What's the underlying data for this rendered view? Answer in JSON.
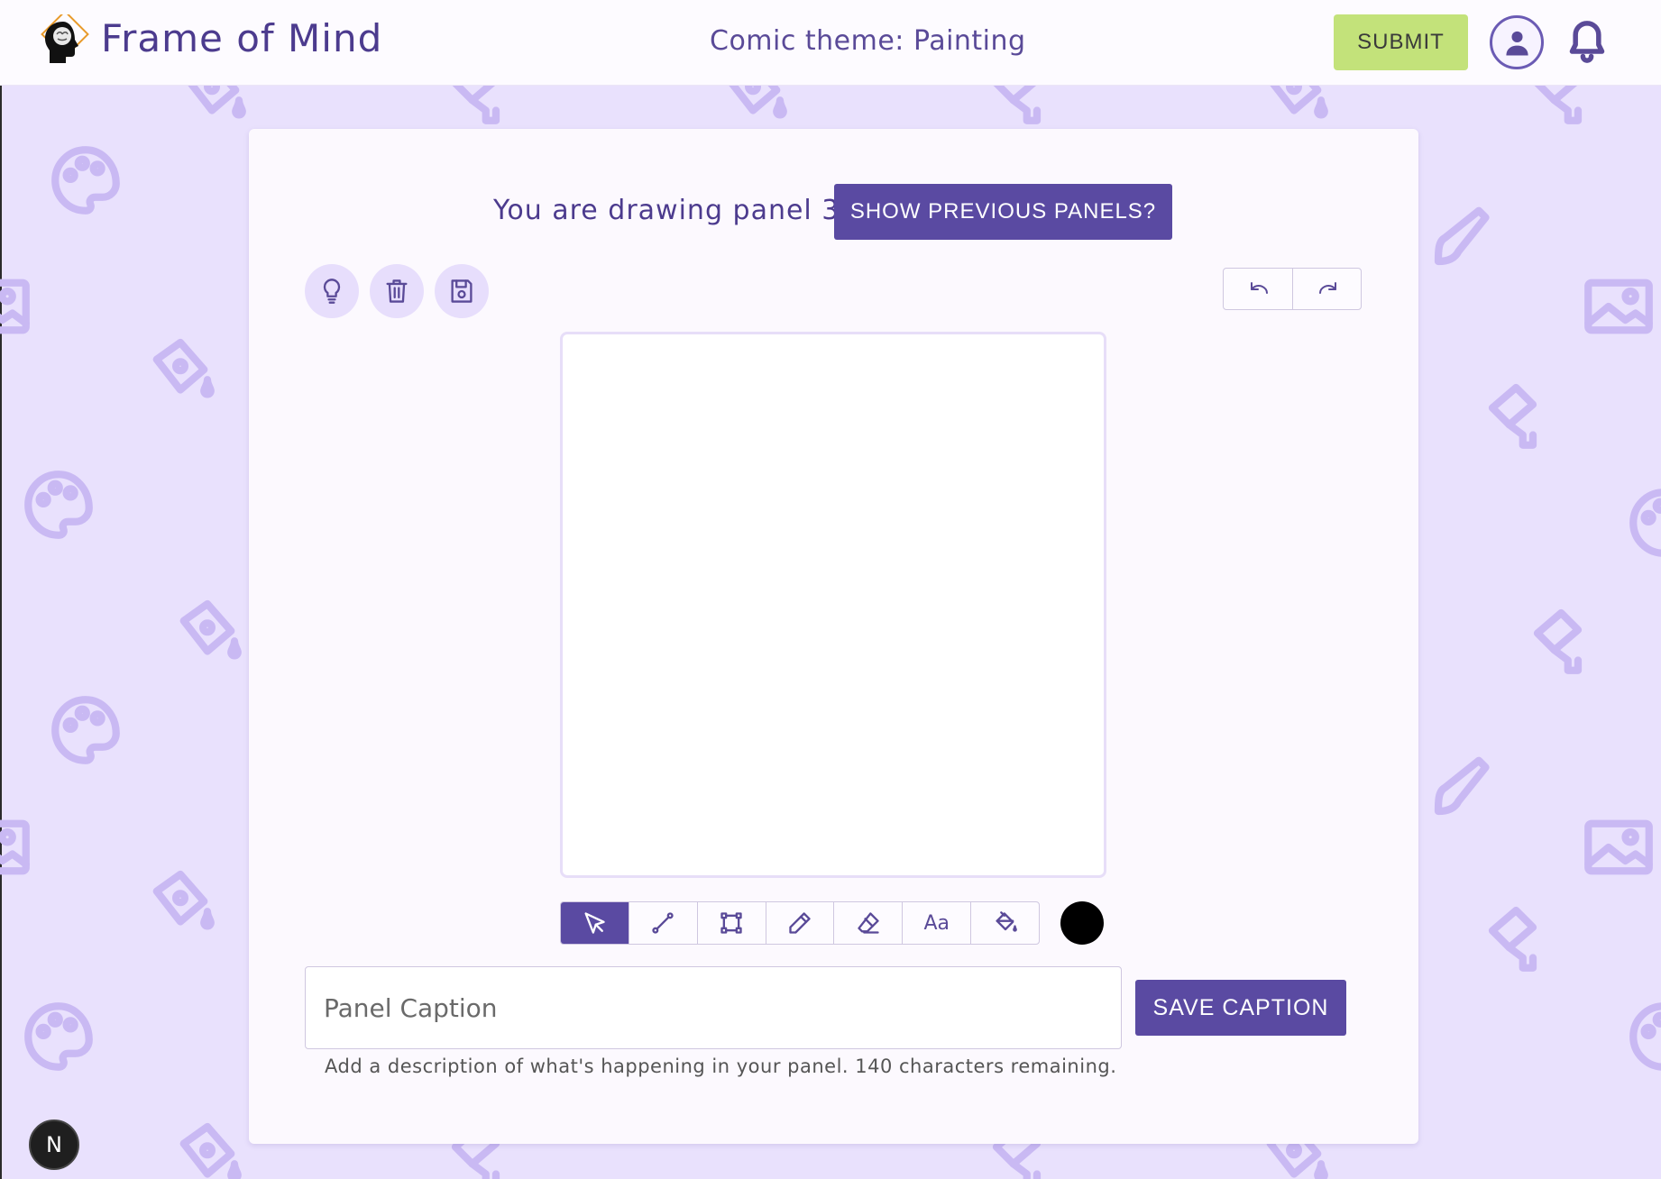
{
  "header": {
    "app_title": "Frame of Mind",
    "theme_label": "Comic theme: Painting",
    "submit_label": "SUBMIT"
  },
  "panel": {
    "drawing_label": "You are drawing panel 3",
    "show_previous_label": "SHOW PREVIOUS PANELS?"
  },
  "side_tools": [
    {
      "name": "lightbulb-icon"
    },
    {
      "name": "trash-icon"
    },
    {
      "name": "save-disk-icon"
    }
  ],
  "history": {
    "undo": "undo-icon",
    "redo": "redo-icon"
  },
  "toolbar": {
    "active_tool": "select",
    "text_tool_glyph": "Aa",
    "tools": [
      "select",
      "line",
      "shape",
      "pencil",
      "eraser",
      "text",
      "fill"
    ]
  },
  "color": {
    "current": "#000000"
  },
  "caption": {
    "placeholder": "Panel Caption",
    "value": "",
    "save_label": "SAVE CAPTION",
    "helper": "Add a description of what's happening in your panel. 140 characters remaining."
  },
  "badge": {
    "letter": "N"
  },
  "colors": {
    "accent": "#5a4aa2",
    "submit": "#c3e27a",
    "background": "#e9e1fd"
  }
}
